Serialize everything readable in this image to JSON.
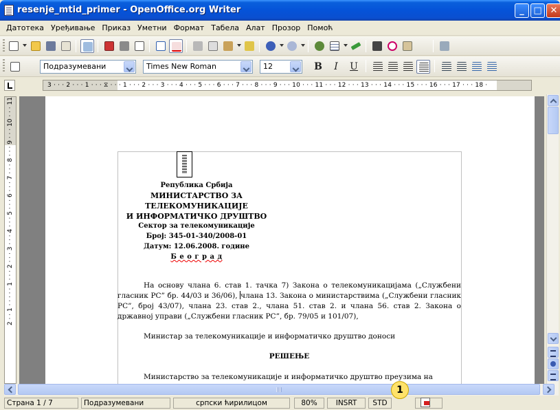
{
  "window": {
    "title": "resenje_mtid_primer - OpenOffice.org Writer"
  },
  "menu": {
    "items": [
      "Датотека",
      "Уређивање",
      "Приказ",
      "Уметни",
      "Формат",
      "Табела",
      "Алат",
      "Прозор",
      "Помоћ"
    ]
  },
  "formatting": {
    "style": "Подразумевани",
    "font": "Times New Roman",
    "size": "12",
    "bold": "B",
    "italic": "I",
    "underline": "U"
  },
  "ruler": {
    "horizontal": "3 · · · 2 · · · 1 · · · ⧖ · · · 1 · · · 2 · · · 3 · · · 4 · · · 5 · · · 6 · · · 7 · · · 8 · · · 9 · · · 10 · · · 11 · · · 12 · · · 13 · · · 14 · · · 15 · · · 16 · · · 17 · · · 18 ·",
    "vertical": "2 · · 1 · · · · · 1 · · · 2 · · · 3 · · · 4 · · · 5 · · · 6 · · · 7 · · · 8 · · · 9 · · · 10 · · · 11"
  },
  "document": {
    "header": {
      "line1": "Република Србија",
      "line2": "МИНИСТАРСТВО ЗА",
      "line3": "ТЕЛЕКОМУНИКАЦИЈЕ",
      "line4": "И ИНФОРМАТИЧКО ДРУШТВО",
      "line5": "Сектор за телекомуникације",
      "line6": "Број: 345-01-340/2008-01",
      "line7": "Датум: 12.06.2008. године",
      "line8": "Б е о г р а д"
    },
    "para1_a": "На основу члана 6. став 1. тачка 7) Закона о телекомуникацијама („Службени гласник РС” бр. 44/03 и 36/06),",
    "para1_b": "члана 13. Закона о министарствима („Службени гласник РС”, број 43/07), члана 23. став 2., члана 51. став 2. и члана 56. став 2. Закона о државној управи („Службени гласник РС”, бр. 79/05 и 101/07),",
    "para2": "Министар за телекомуникације и информатичко друштво доноси",
    "heading": "РЕШЕЊЕ",
    "para3": "Министарство за телекомуникације и информатичко друштво преузима на"
  },
  "status": {
    "page": "Страна 1 / 7",
    "style": "Подразумевани",
    "language": "српски ћирилицом",
    "zoom": "80%",
    "insert_mode": "INSRT",
    "selection_mode": "STD",
    "badge": "1"
  },
  "icons": {
    "new": "new-document-icon",
    "open": "open-folder-icon",
    "save": "save-icon",
    "email": "email-icon",
    "edit": "edit-file-icon",
    "pdf": "export-pdf-icon",
    "print": "print-icon",
    "preview": "page-preview-icon",
    "spell": "spellcheck-icon",
    "autospell": "autospellcheck-icon",
    "cut": "cut-icon",
    "copy": "copy-icon",
    "paste": "paste-icon",
    "clone": "clone-formatting-icon",
    "undo": "undo-icon",
    "redo": "redo-icon",
    "hyperlink": "hyperlink-icon",
    "table": "insert-table-icon",
    "show_draw": "draw-functions-icon",
    "find": "find-replace-icon",
    "navigator": "navigator-icon",
    "gallery": "gallery-icon"
  }
}
